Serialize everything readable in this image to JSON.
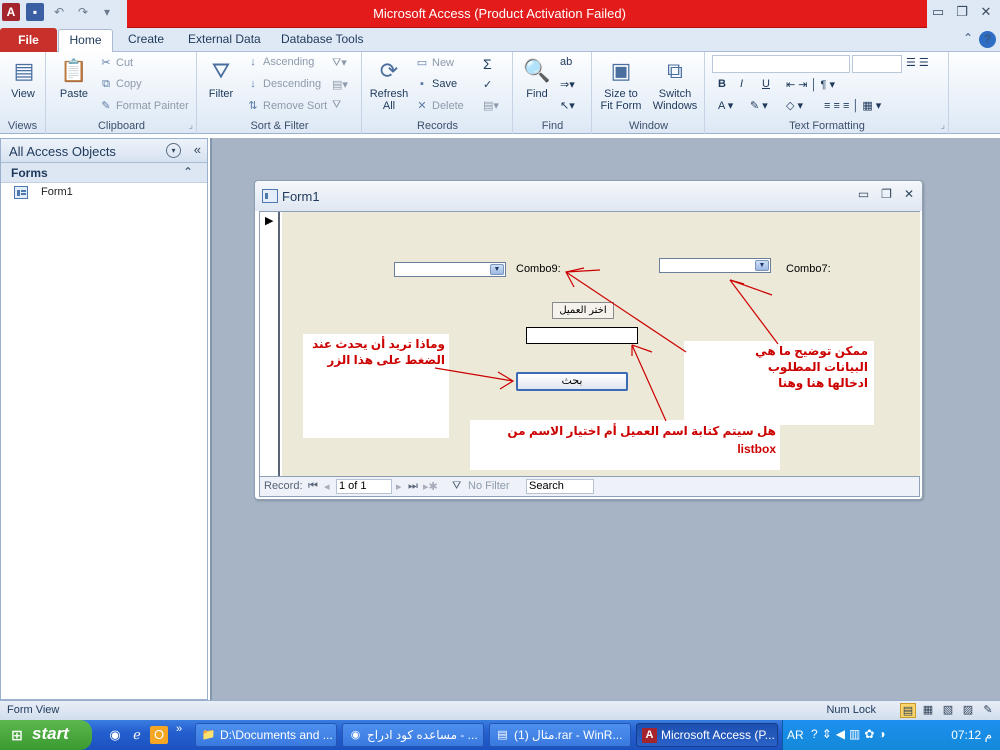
{
  "window": {
    "title": "Microsoft Access (Product Activation Failed)"
  },
  "tabs": {
    "file": "File",
    "home": "Home",
    "create": "Create",
    "external": "External Data",
    "dbtools": "Database Tools"
  },
  "ribbon": {
    "views": {
      "view": "View",
      "label": "Views"
    },
    "clipboard": {
      "paste": "Paste",
      "cut": "Cut",
      "copy": "Copy",
      "format_painter": "Format Painter",
      "label": "Clipboard"
    },
    "sort_filter": {
      "filter": "Filter",
      "ascending": "Ascending",
      "descending": "Descending",
      "remove_sort": "Remove Sort",
      "label": "Sort & Filter"
    },
    "records": {
      "refresh": "Refresh",
      "refresh_all": "All",
      "new": "New",
      "save": "Save",
      "delete": "Delete",
      "totals": "Σ",
      "label": "Records"
    },
    "find": {
      "find": "Find",
      "label": "Find"
    },
    "window": {
      "size_to": "Size to",
      "fit_form": "Fit Form",
      "switch": "Switch",
      "windows": "Windows",
      "label": "Window"
    },
    "text_formatting": {
      "bold": "B",
      "italic": "I",
      "underline": "U",
      "label": "Text Formatting"
    }
  },
  "nav": {
    "title": "All Access Objects",
    "section": "Forms",
    "items": [
      {
        "label": "Form1"
      }
    ]
  },
  "form": {
    "title": "Form1",
    "combo9_label": "Combo9:",
    "combo7_label": "Combo7:",
    "choose_customer_button": "اختر العميل",
    "search_button": "بحث",
    "notes": {
      "left": "وماذا تريد أن يحدث عند الضغط على هذا الزر",
      "right": "ممكن توضيح ما هي البيانات المطلوب ادخالها هنا وهنا",
      "bottom": "هل سيتم كتابة اسم العميل أم اختيار الاسم من listbox"
    },
    "recordbar": {
      "record_label": "Record:",
      "position": "1 of 1",
      "no_filter": "No Filter",
      "search": "Search"
    }
  },
  "status": {
    "left": "Form View",
    "numlock": "Num Lock"
  },
  "taskbar": {
    "start": "start",
    "tasks": [
      {
        "label": "D:\\Documents and ..."
      },
      {
        "label": "مساعده كود ادراج - ..."
      },
      {
        "label": "مثال (1).rar - WinR..."
      },
      {
        "label": "Microsoft Access (P..."
      }
    ],
    "lang": "AR",
    "clock": "م 07:12"
  },
  "colors": {
    "title_red": "#e31b1b",
    "note_text": "#cc0000",
    "form_bg": "#ece9d8",
    "workspace": "#a6b4c5"
  }
}
